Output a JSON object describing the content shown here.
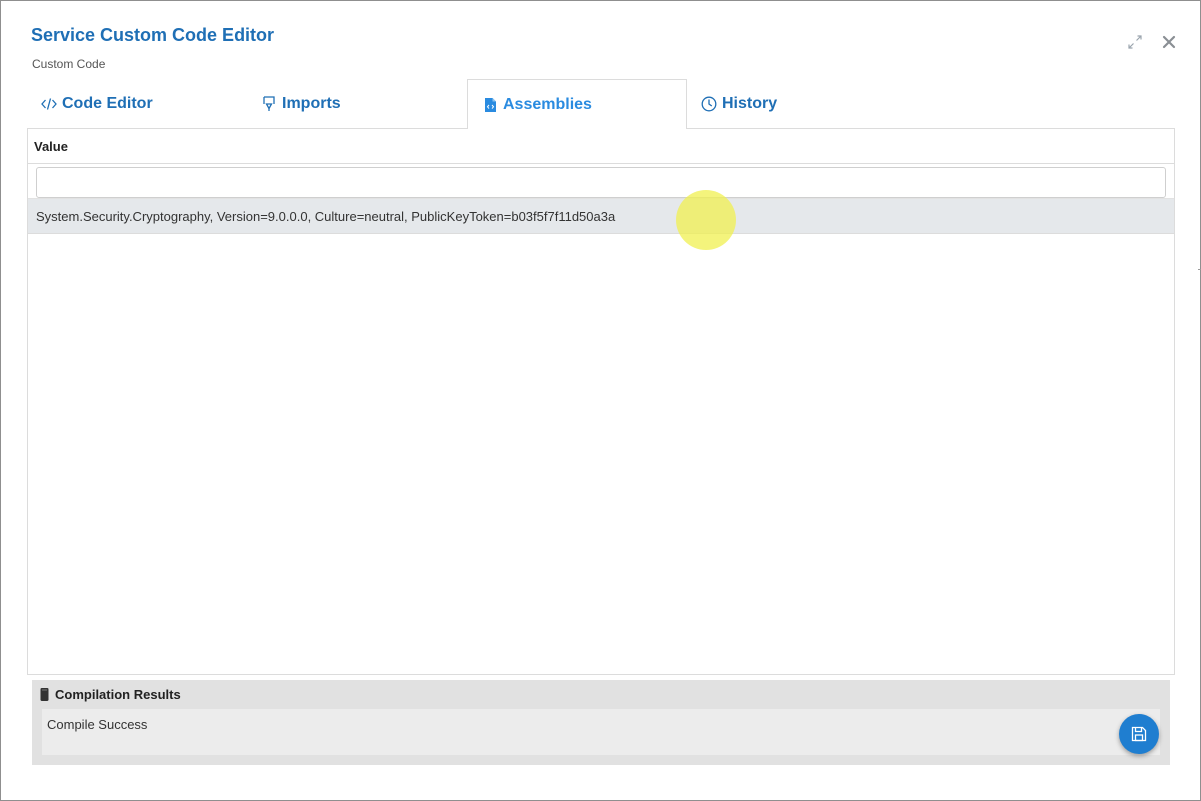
{
  "dialog": {
    "title": "Service Custom Code Editor",
    "subtitle": "Custom Code"
  },
  "header_icons": [
    "expand-icon",
    "close-icon"
  ],
  "tabs": [
    {
      "label": "Code Editor",
      "icon": "code-icon",
      "active": false
    },
    {
      "label": "Imports",
      "icon": "import-icon",
      "active": false
    },
    {
      "label": "Assemblies",
      "icon": "file-code-icon",
      "active": true
    },
    {
      "label": "History",
      "icon": "clock-icon",
      "active": false
    }
  ],
  "grid": {
    "column_header": "Value",
    "filter_value": "",
    "rows": [
      {
        "value": "System.Security.Cryptography, Version=9.0.0.0, Culture=neutral, PublicKeyToken=b03f5f7f11d50a3a"
      }
    ]
  },
  "compilation": {
    "header": "Compilation Results",
    "message": "Compile Success"
  },
  "colors": {
    "accent": "#1f6fb5",
    "active_tab": "#2a8be0",
    "selected_row": "#e5e8eb",
    "fab": "#1f7ed0"
  }
}
